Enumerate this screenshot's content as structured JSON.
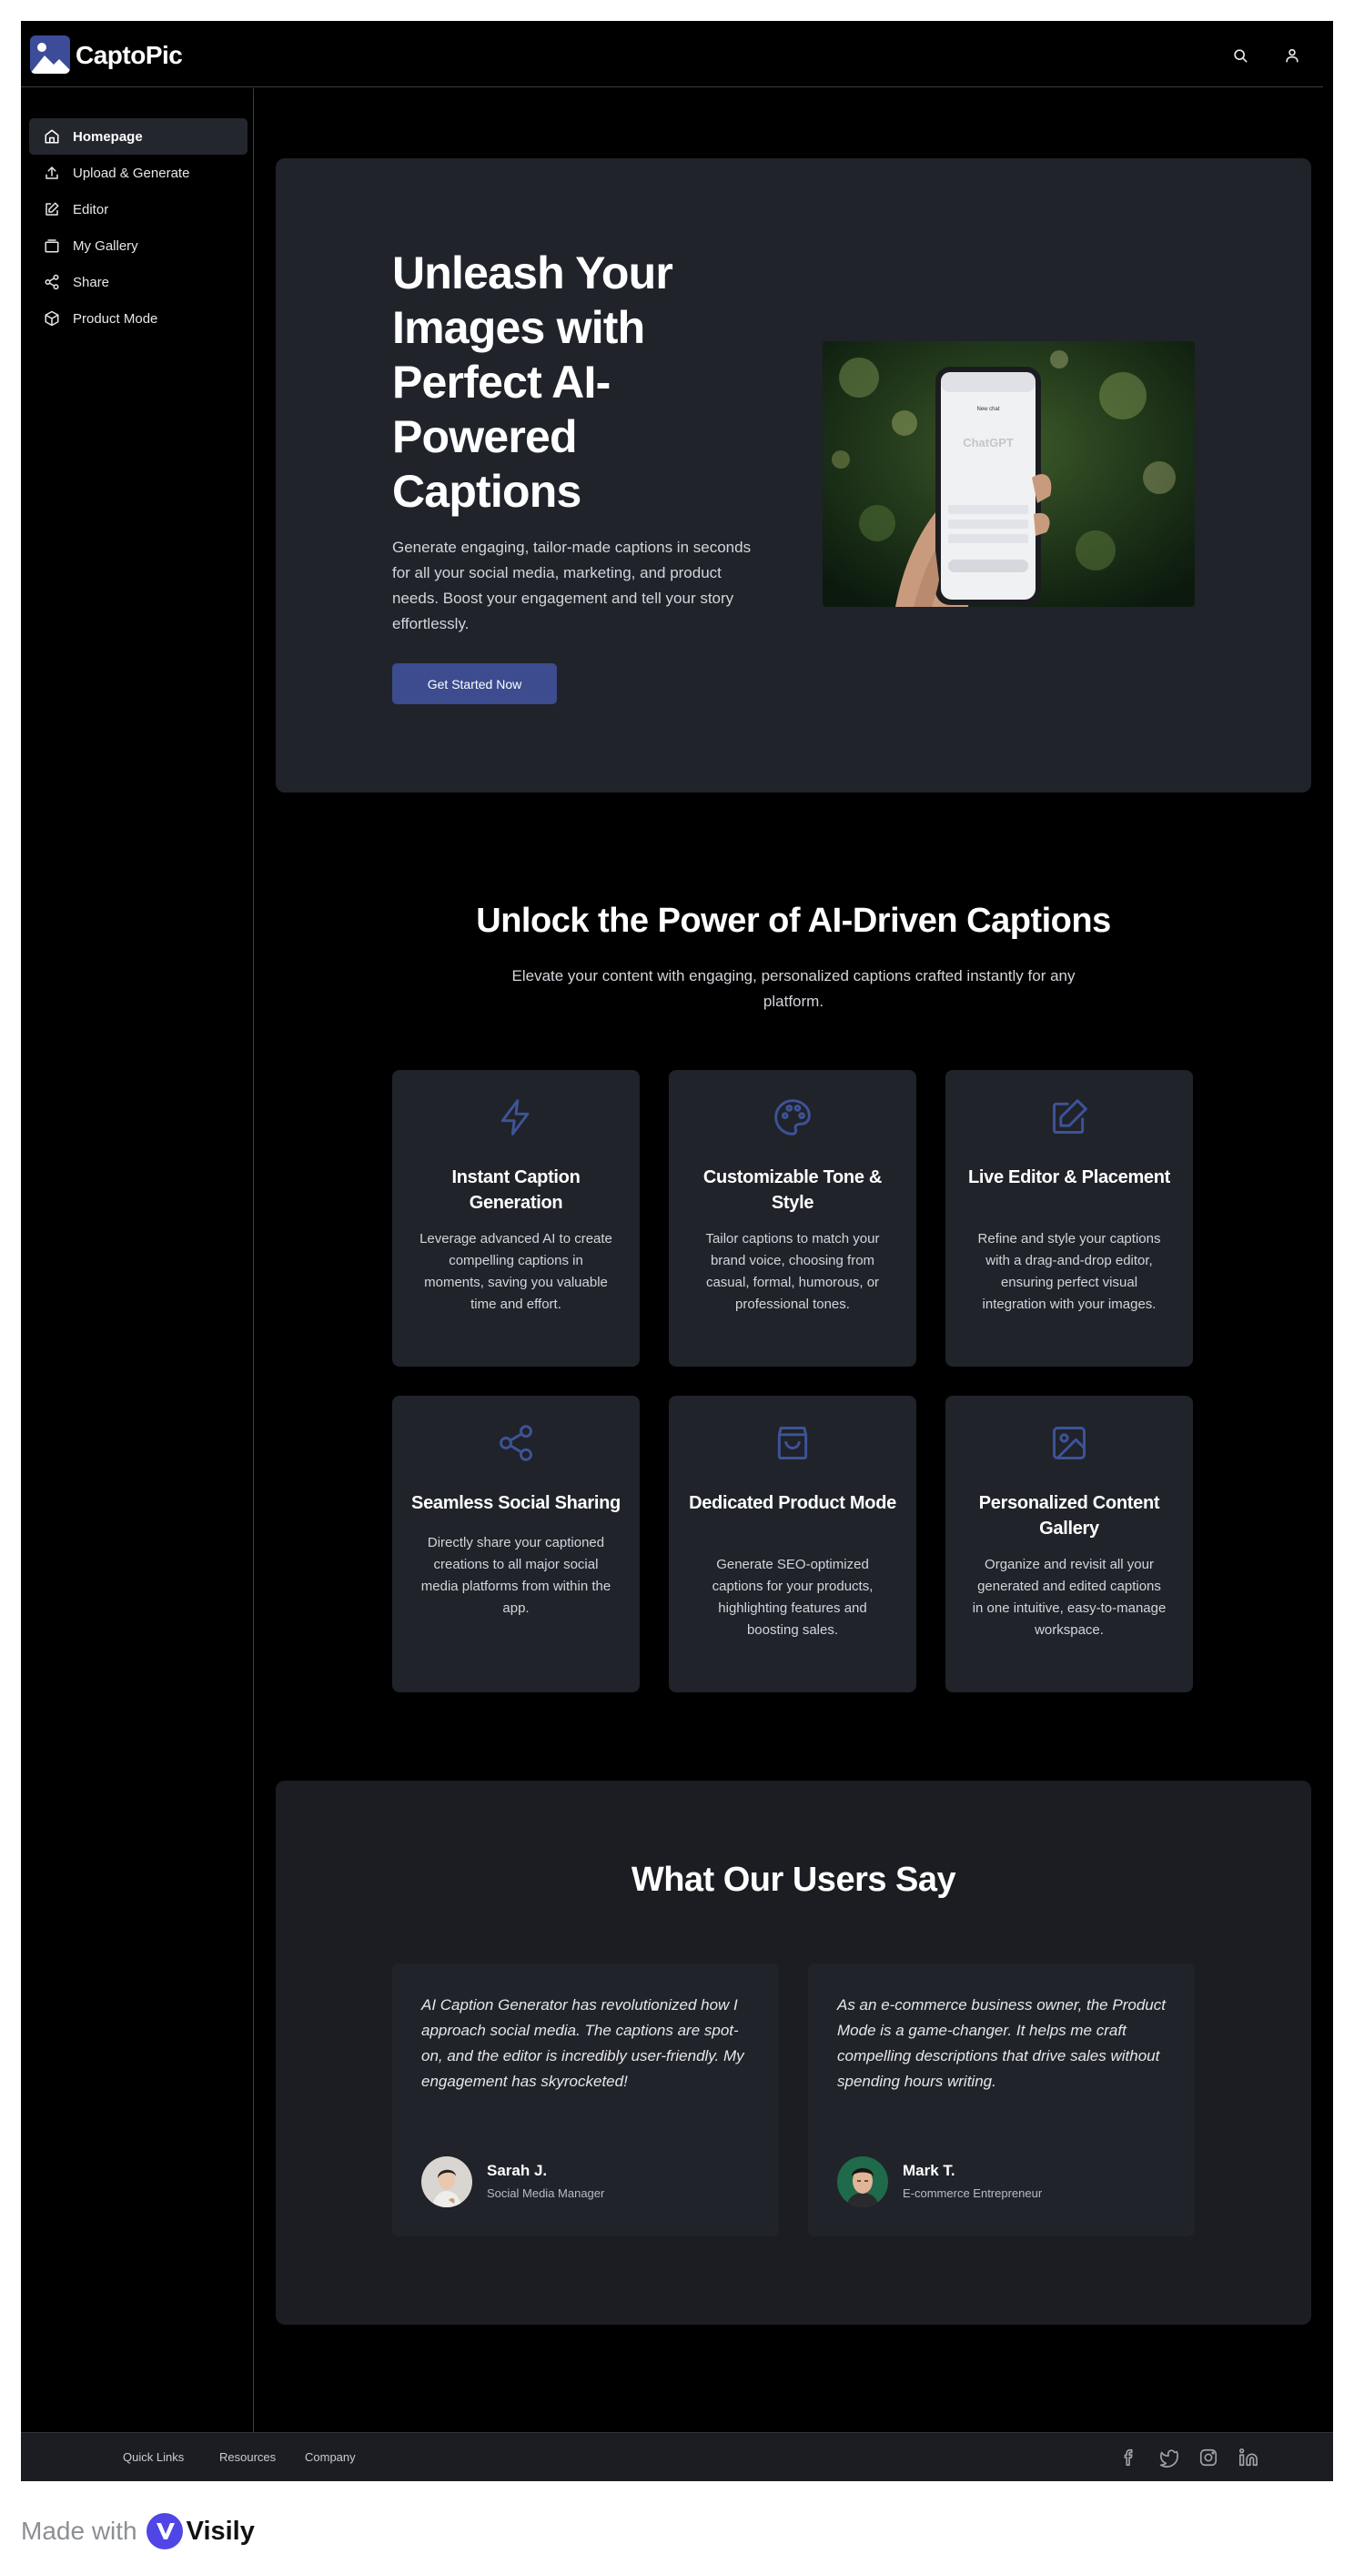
{
  "app": {
    "brand": "CaptoPic"
  },
  "header": {
    "search_icon": "search-icon",
    "user_icon": "user-icon"
  },
  "sidebar": {
    "items": [
      {
        "label": "Homepage",
        "icon": "home-icon",
        "active": true
      },
      {
        "label": "Upload & Generate",
        "icon": "upload-icon",
        "active": false
      },
      {
        "label": "Editor",
        "icon": "edit-icon",
        "active": false
      },
      {
        "label": "My Gallery",
        "icon": "gallery-icon",
        "active": false
      },
      {
        "label": "Share",
        "icon": "share-icon",
        "active": false
      },
      {
        "label": "Product Mode",
        "icon": "box-icon",
        "active": false
      }
    ]
  },
  "hero": {
    "title": "Unleash Your Images with Perfect AI-Powered Captions",
    "description": "Generate engaging, tailor-made captions in seconds for all your social media, marketing, and product needs. Boost your engagement and tell your story effortlessly.",
    "cta_label": "Get Started Now",
    "image": {
      "phone_header": "New chat",
      "phone_brand": "ChatGPT"
    }
  },
  "features": {
    "title": "Unlock the Power of AI-Driven Captions",
    "subtitle": "Elevate your content with engaging, personalized captions crafted instantly for any platform.",
    "cards": [
      {
        "icon": "lightning-icon",
        "title": "Instant Caption Generation",
        "desc": "Leverage advanced AI to create compelling captions in moments, saving you valuable time and effort."
      },
      {
        "icon": "palette-icon",
        "title": "Customizable Tone & Style",
        "desc": "Tailor captions to match your brand voice, choosing from casual, formal, humorous, or professional tones."
      },
      {
        "icon": "edit-square-icon",
        "title": "Live Editor & Placement",
        "desc": "Refine and style your captions with a drag-and-drop editor, ensuring perfect visual integration with your images."
      },
      {
        "icon": "share-icon",
        "title": "Seamless Social Sharing",
        "desc": "Directly share your captioned creations to all major social media platforms from within the app."
      },
      {
        "icon": "shopping-bag-icon",
        "title": "Dedicated Product Mode",
        "desc": "Generate SEO-optimized captions for your products, highlighting features and boosting sales."
      },
      {
        "icon": "image-icon",
        "title": "Personalized Content Gallery",
        "desc": "Organize and revisit all your generated and edited captions in one intuitive, easy-to-manage workspace."
      }
    ]
  },
  "testimonials": {
    "title": "What Our Users Say",
    "items": [
      {
        "quote": "AI Caption Generator has revolutionized how I approach social media. The captions are spot-on, and the editor is incredibly user-friendly. My engagement has skyrocketed!",
        "name": "Sarah J.",
        "role": "Social Media Manager"
      },
      {
        "quote": "As an e-commerce business owner, the Product Mode is a game-changer. It helps me craft compelling descriptions that drive sales without spending hours writing.",
        "name": "Mark T.",
        "role": "E-commerce Entrepreneur"
      }
    ]
  },
  "footer": {
    "links": [
      "Quick Links",
      "Resources",
      "Company"
    ],
    "social_icons": [
      "facebook-icon",
      "twitter-icon",
      "instagram-icon",
      "linkedin-icon"
    ]
  },
  "badge": {
    "prefix": "Made with",
    "name": "Visily"
  },
  "colors": {
    "accent": "#3c4c8f",
    "panel": "#20232a",
    "background": "#000000",
    "icon_blue": "#3e5398"
  }
}
